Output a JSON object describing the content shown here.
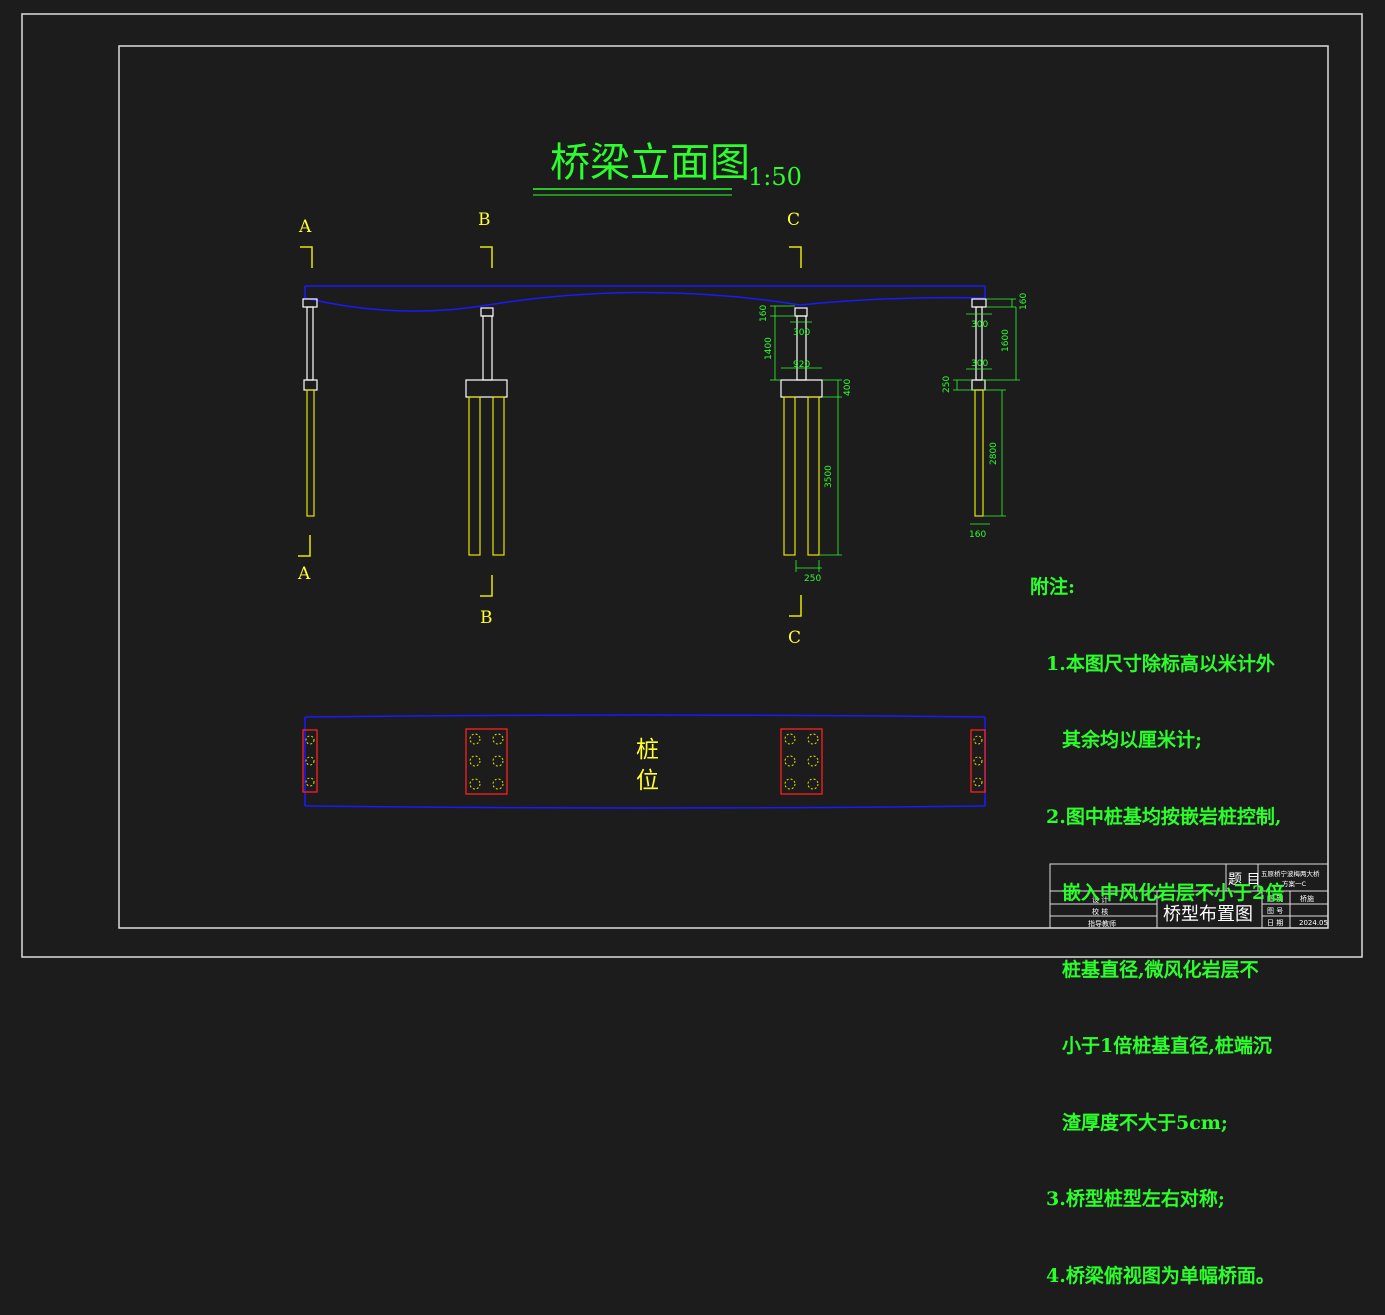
{
  "drawing": {
    "main_title": "桥梁立面图",
    "scale": "1:50",
    "section_labels": [
      "A",
      "B",
      "C"
    ],
    "pile_plan_label_line1": "桩",
    "pile_plan_label_line2": "位",
    "dimensions": {
      "d160a": "160",
      "d300a": "300",
      "d1400": "1400",
      "d920": "920",
      "d400": "400",
      "d3500": "3500",
      "d250a": "250",
      "d160b": "160",
      "d300b": "300",
      "d1600": "1600",
      "d300c": "300",
      "d250b": "250",
      "d2800": "2800",
      "d160c": "160"
    },
    "colors": {
      "background": "#1c1c1c",
      "frame": "#ffffff",
      "deck": "#1a1aff",
      "pile": "#e6e600",
      "text_green": "#2bff2b",
      "label_yellow": "#ffff33",
      "plan_box": "#ff2020"
    }
  },
  "notes": {
    "title": "附注:",
    "items": [
      "1.本图尺寸除标高以米计外",
      "其余均以厘米计;",
      "2.图中桩基均按嵌岩桩控制,",
      "嵌入中风化岩层不小于2倍",
      "桩基直径,微风化岩层不",
      "小于1倍桩基直径,桩端沉",
      "渣厚度不大于5cm;",
      "3.桥型桩型左右对称;",
      "4.桥梁俯视图为单幅桥面。"
    ]
  },
  "title_block": {
    "label_title": "题 目",
    "project_name": "五原桥宁波梅两大桥",
    "project_sub": "方案一C",
    "row1": "设 计",
    "row2": "校 核",
    "row3": "指导教师",
    "drawing_name": "桥型布置图",
    "r_label1": "图 别",
    "r_value1": "桥施",
    "r_label2": "图 号",
    "r_value2": "",
    "r_label3": "日 期",
    "r_value3": "2024.05"
  }
}
